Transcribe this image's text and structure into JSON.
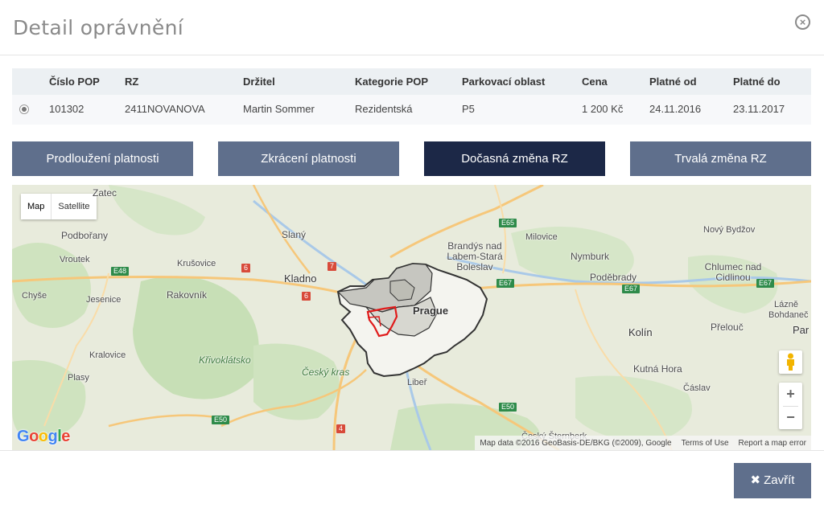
{
  "modal": {
    "title": "Detail oprávnění",
    "close_icon": "close-circle-icon"
  },
  "table": {
    "headers": [
      "Číslo POP",
      "RZ",
      "Držitel",
      "Kategorie POP",
      "Parkovací oblast",
      "Cena",
      "Platné od",
      "Platné do"
    ],
    "rows": [
      {
        "selected": true,
        "cislo_pop": "101302",
        "rz": "2411NOVANOVA",
        "drzitel": "Martin Sommer",
        "kategorie": "Rezidentská",
        "oblast": "P5",
        "cena": "1 200 Kč",
        "platne_od": "24.11.2016",
        "platne_do": "23.11.2017"
      }
    ]
  },
  "actions": {
    "prodlouzeni": "Prodloužení platnosti",
    "zkraceni": "Zkrácení platnosti",
    "docasna": "Dočasná změna RZ",
    "trvala": "Trvalá změna RZ",
    "active": "docasna"
  },
  "map": {
    "type_map": "Map",
    "type_satellite": "Satellite",
    "selected_type": "Map",
    "zoom_in": "+",
    "zoom_out": "−",
    "logo": "Google",
    "attribution": "Map data ©2016 GeoBasis-DE/BKG (©2009), Google",
    "terms": "Terms of Use",
    "report": "Report a map error",
    "places": {
      "zatec": "Zatec",
      "podborany": "Podbořany",
      "vroutek": "Vroutek",
      "krusovice": "Krušovice",
      "slany": "Slaný",
      "kladno": "Kladno",
      "rakovnik": "Rakovník",
      "chyse": "Chyše",
      "jesenice": "Jesenice",
      "kralovice": "Kralovice",
      "plasy": "Plasy",
      "krivoklatsko": "Křivoklátsko",
      "cesky_kras": "Český kras",
      "brandys": "Brandýs nad Labem-Stará Boleslav",
      "milovice": "Milovice",
      "nymburk": "Nymburk",
      "podebrady": "Poděbrady",
      "kolin": "Kolín",
      "kutna_hora": "Kutná Hora",
      "caslav": "Čáslav",
      "novy_bydzov": "Nový Bydžov",
      "chlumec": "Chlumec nad Cidlinou",
      "prelouc": "Přelouč",
      "lazne_bohdanec": "Lázně Bohdaneč",
      "par": "Par",
      "liber": "Libeř",
      "prague": "Prague",
      "cesky_sternberk": "Český Šternberk"
    },
    "roads": [
      "E48",
      "E65",
      "E67",
      "E67",
      "E67",
      "E50",
      "E50",
      "6",
      "6",
      "7",
      "4"
    ]
  },
  "footer": {
    "close_label": "Zavřít"
  },
  "colors": {
    "button": "#5f6f8c",
    "button_active": "#1c2847",
    "selected_area": "#e01b1b"
  }
}
